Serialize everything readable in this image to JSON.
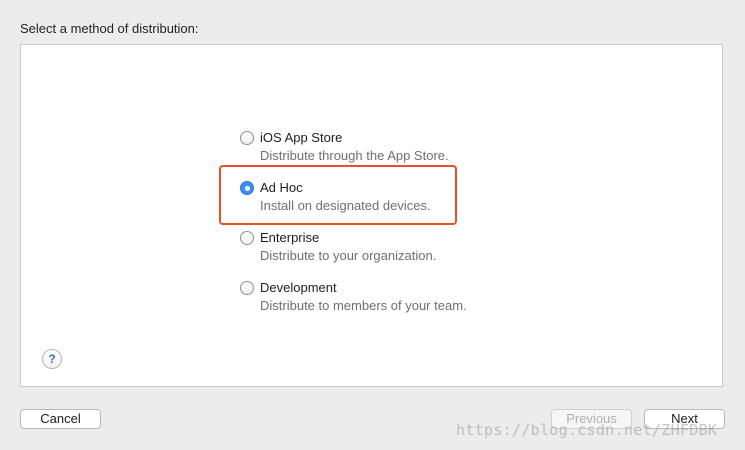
{
  "header": {
    "prompt": "Select a method of distribution:"
  },
  "options": [
    {
      "label": "iOS App Store",
      "description": "Distribute through the App Store.",
      "selected": false
    },
    {
      "label": "Ad Hoc",
      "description": "Install on designated devices.",
      "selected": true
    },
    {
      "label": "Enterprise",
      "description": "Distribute to your organization.",
      "selected": false
    },
    {
      "label": "Development",
      "description": "Distribute to members of your team.",
      "selected": false
    }
  ],
  "help": {
    "label": "?",
    "icon": "question-icon"
  },
  "footer": {
    "cancel_label": "Cancel",
    "previous_label": "Previous",
    "next_label": "Next"
  },
  "watermark": "https://blog.csdn.net/ZHFDBK",
  "colors": {
    "accent": "#3c8cf2",
    "highlight": "#e8502a"
  }
}
